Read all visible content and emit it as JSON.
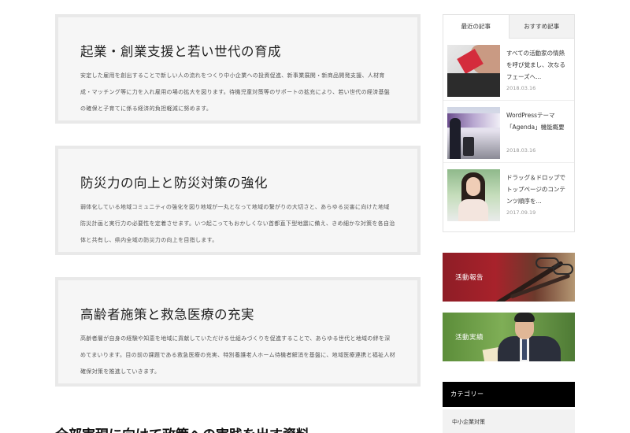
{
  "policies": [
    {
      "title": "起業・創業支援と若い世代の育成",
      "body": "安定した雇用を創出することで新しい人の流れをつくり中小企業への投資促進、新事業展開・新商品開発支援、人材育成・マッチング等に力を入れ雇用の場の拡大を図ります。待機児童対策等のサポートの拡充により、若い世代の経済基盤の確保と子育てに係る経済的負担軽減に努めます。"
    },
    {
      "title": "防災力の向上と防災対策の強化",
      "body": "弱体化している地域コミュニティの強化を図り地域が一丸となって地域の繋がりの大切さと、あらゆる災害に向けた地域防災計画と実行力の必要性を定着させます。いつ起こってもおかしくない首都直下型地震に備え、きめ細かな対策を各自治体と共有し、県内全域の防災力の向上を目指します。"
    },
    {
      "title": "高齢者施策と救急医療の充実",
      "body": "高齢者層が自身の経験や知恵を地域に貢献していただける仕組みづくりを促進することで、あらゆる世代と地域の絆を深めてまいります。目の前の課題である救急医療の充実、特別養護老人ホーム待機者解消を基盤に、地域医療連携と福祉人材確保対策を推進していきます。"
    }
  ],
  "bottom_heading": "全部実現に向けて政策への実践を出す資料",
  "tabs": {
    "items": [
      {
        "label": "最近の記事",
        "active": true
      },
      {
        "label": "おすすめ記事",
        "active": false
      }
    ],
    "articles": [
      {
        "title": "すべての活動家の情熱を呼び覚まし、次なるフェーズへ...",
        "date": "2018.03.16"
      },
      {
        "title": "WordPressテーマ「Agenda」機能概要",
        "date": "2018.03.16"
      },
      {
        "title": "ドラッグ＆ドロップでトップページのコンテンツ順序を...",
        "date": "2017.09.19"
      }
    ]
  },
  "banners": [
    {
      "label": "活動報告"
    },
    {
      "label": "活動実績"
    }
  ],
  "category": {
    "header": "カテゴリー",
    "items": [
      "中小企業対策"
    ]
  }
}
